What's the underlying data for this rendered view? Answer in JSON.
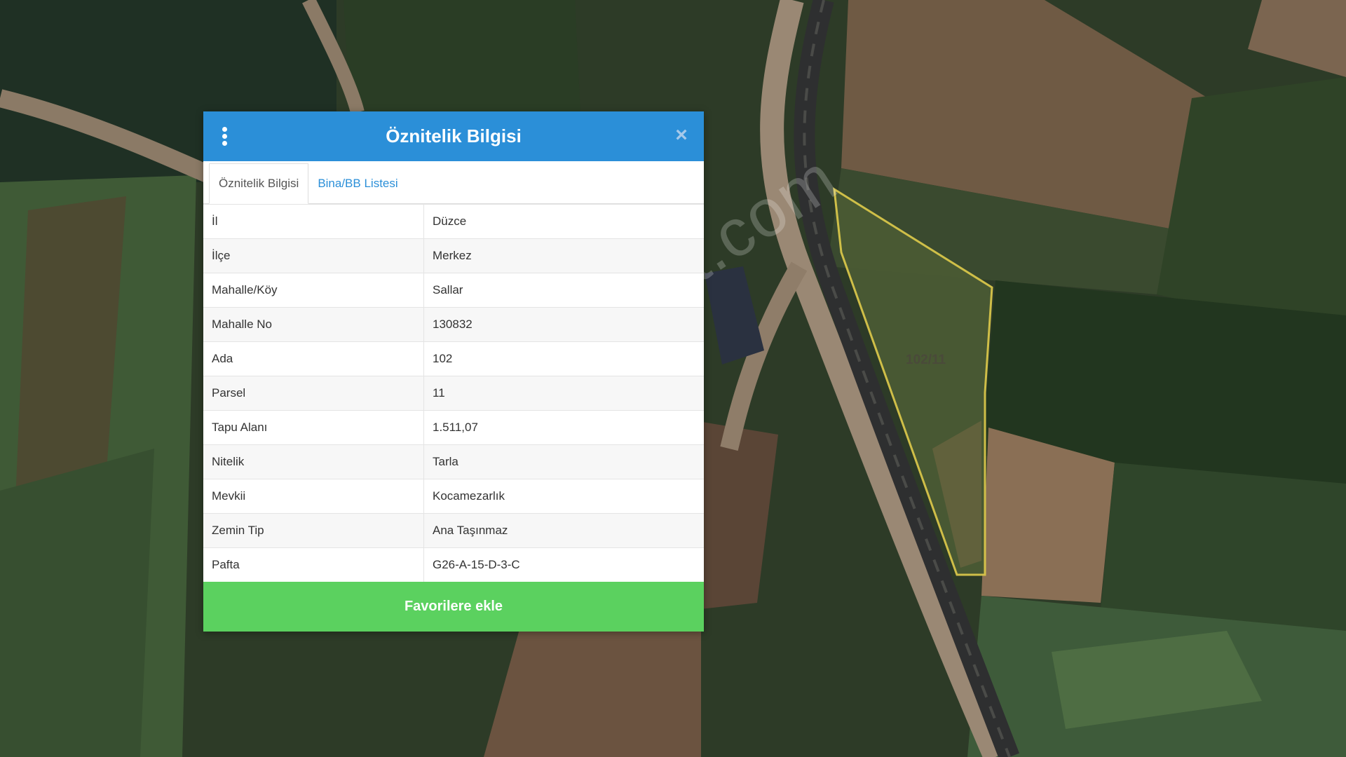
{
  "panel": {
    "title": "Öznitelik Bilgisi",
    "menu_icon": "vertical-dots-icon",
    "close_icon": "close-icon",
    "close_glyph": "×"
  },
  "tabs": [
    {
      "label": "Öznitelik Bilgisi"
    },
    {
      "label": "Bina/BB Listesi"
    }
  ],
  "attributes": [
    {
      "key": "İl",
      "value": "Düzce"
    },
    {
      "key": "İlçe",
      "value": "Merkez"
    },
    {
      "key": "Mahalle/Köy",
      "value": "Sallar"
    },
    {
      "key": "Mahalle No",
      "value": "130832"
    },
    {
      "key": "Ada",
      "value": "102"
    },
    {
      "key": "Parsel",
      "value": "11"
    },
    {
      "key": "Tapu Alanı",
      "value": "1.511,07"
    },
    {
      "key": "Nitelik",
      "value": "Tarla"
    },
    {
      "key": "Mevkii",
      "value": "Kocamezarlık"
    },
    {
      "key": "Zemin Tip",
      "value": "Ana Taşınmaz"
    },
    {
      "key": "Pafta",
      "value": "G26-A-15-D-3-C"
    }
  ],
  "favorite_button": {
    "label": "Favorilere ekle"
  },
  "map": {
    "parcel_label": "102/11",
    "watermark": "emlakjet.com"
  },
  "colors": {
    "header": "#2b8fd8",
    "favorite": "#5bd15f",
    "parcel_outline": "#d8c64a"
  }
}
